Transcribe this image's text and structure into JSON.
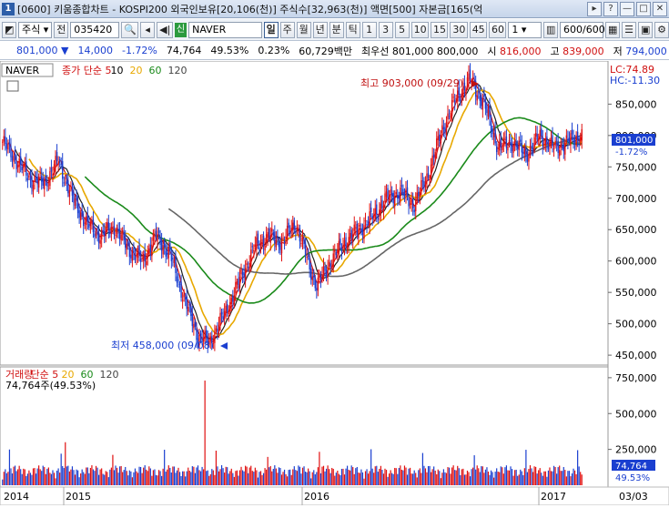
{
  "window": {
    "title": "[0600] 키움종합차트 - KOSPI200 외국인보유[20,106(천)] 주식수[32,963(천)] 액면[500] 자본금[165(억",
    "icon_label": "1",
    "buttons": [
      "▸",
      "?",
      "—",
      "□",
      "✕"
    ]
  },
  "toolbar": {
    "market": "주식",
    "code_label": "전",
    "code": "035420",
    "name_badge": "신",
    "name": "NAVER",
    "periods": [
      "일",
      "주",
      "월",
      "년",
      "분",
      "틱",
      "1",
      "3",
      "5",
      "10",
      "15",
      "30",
      "45",
      "60"
    ],
    "active_period": "일",
    "interval_value": "1",
    "count": "600/600"
  },
  "quote": {
    "price": "801,000",
    "change": "14,000",
    "change_pct": "-1.72%",
    "volume": "74,764",
    "vol_ratio": "49.53%",
    "turnover_pct": "0.23%",
    "amount": "60,729백만",
    "ask_label": "최우선",
    "best_ask": "801,000",
    "best_bid": "800,000",
    "open_label": "시",
    "open": "816,000",
    "high_label": "고",
    "high": "839,000",
    "low_label": "저",
    "low": "794,000"
  },
  "price_panel": {
    "name_box": "NAVER",
    "legend": [
      {
        "text": "종가 단순 5",
        "color": "#d01010"
      },
      {
        "text": "10",
        "color": "#000000"
      },
      {
        "text": "20",
        "color": "#e8a800"
      },
      {
        "text": "60",
        "color": "#1a8a1a"
      },
      {
        "text": "120",
        "color": "#444444"
      }
    ],
    "lc_label": "LC:74.89",
    "hc_label": "HC:-11.30",
    "y_ticks": [
      "850,000",
      "800,000",
      "750,000",
      "700,000",
      "650,000",
      "600,000",
      "550,000",
      "500,000",
      "450,000"
    ],
    "current_price_label": "801,000",
    "current_change_label": "-1.72%",
    "high_annotation": "최고 903,000 (09/29)",
    "low_annotation": "최저 458,000 (09/08)"
  },
  "volume_panel": {
    "legend": [
      {
        "text": "거래량",
        "color": "#d01010"
      },
      {
        "text": "단순 5",
        "color": "#d01010"
      },
      {
        "text": "20",
        "color": "#e8a800"
      },
      {
        "text": "60",
        "color": "#1a8a1a"
      },
      {
        "text": "120",
        "color": "#444444"
      }
    ],
    "current_label": "74,764주(49.53%)",
    "y_ticks": [
      "750,000",
      "500,000",
      "250,000"
    ],
    "current_volume_label": "74,764",
    "current_pct_label": "49.53%"
  },
  "x_axis": {
    "labels": [
      "2014",
      "2015",
      "2016",
      "2017"
    ],
    "end_label": "03/03"
  },
  "chart_data": {
    "type": "candlestick",
    "price_ylim": [
      440000,
      910000
    ],
    "price_close_series": [
      {
        "index": 0,
        "value": 790000
      },
      {
        "index": 10,
        "value": 760000
      },
      {
        "index": 20,
        "value": 730000
      },
      {
        "index": 30,
        "value": 725000
      },
      {
        "index": 40,
        "value": 760000
      },
      {
        "index": 50,
        "value": 700000
      },
      {
        "index": 60,
        "value": 660000
      },
      {
        "index": 70,
        "value": 640000
      },
      {
        "index": 80,
        "value": 655000
      },
      {
        "index": 90,
        "value": 620000
      },
      {
        "index": 100,
        "value": 600000
      },
      {
        "index": 110,
        "value": 640000
      },
      {
        "index": 120,
        "value": 610000
      },
      {
        "index": 130,
        "value": 540000
      },
      {
        "index": 140,
        "value": 480000
      },
      {
        "index": 148,
        "value": 470000
      },
      {
        "index": 160,
        "value": 520000
      },
      {
        "index": 170,
        "value": 570000
      },
      {
        "index": 180,
        "value": 620000
      },
      {
        "index": 190,
        "value": 640000
      },
      {
        "index": 200,
        "value": 630000
      },
      {
        "index": 210,
        "value": 660000
      },
      {
        "index": 220,
        "value": 590000
      },
      {
        "index": 225,
        "value": 560000
      },
      {
        "index": 235,
        "value": 600000
      },
      {
        "index": 245,
        "value": 630000
      },
      {
        "index": 255,
        "value": 650000
      },
      {
        "index": 265,
        "value": 670000
      },
      {
        "index": 275,
        "value": 700000
      },
      {
        "index": 285,
        "value": 710000
      },
      {
        "index": 295,
        "value": 690000
      },
      {
        "index": 305,
        "value": 740000
      },
      {
        "index": 315,
        "value": 810000
      },
      {
        "index": 325,
        "value": 860000
      },
      {
        "index": 335,
        "value": 890000
      },
      {
        "index": 345,
        "value": 850000
      },
      {
        "index": 355,
        "value": 780000
      },
      {
        "index": 365,
        "value": 790000
      },
      {
        "index": 375,
        "value": 770000
      },
      {
        "index": 385,
        "value": 800000
      },
      {
        "index": 395,
        "value": 780000
      },
      {
        "index": 405,
        "value": 790000
      },
      {
        "index": 415,
        "value": 801000
      }
    ],
    "max_annotation": {
      "value": 903000,
      "date": "09/29"
    },
    "min_annotation": {
      "value": 458000,
      "date": "09/08"
    },
    "volume_ylim": [
      0,
      800000
    ],
    "last_volume": 74764
  }
}
